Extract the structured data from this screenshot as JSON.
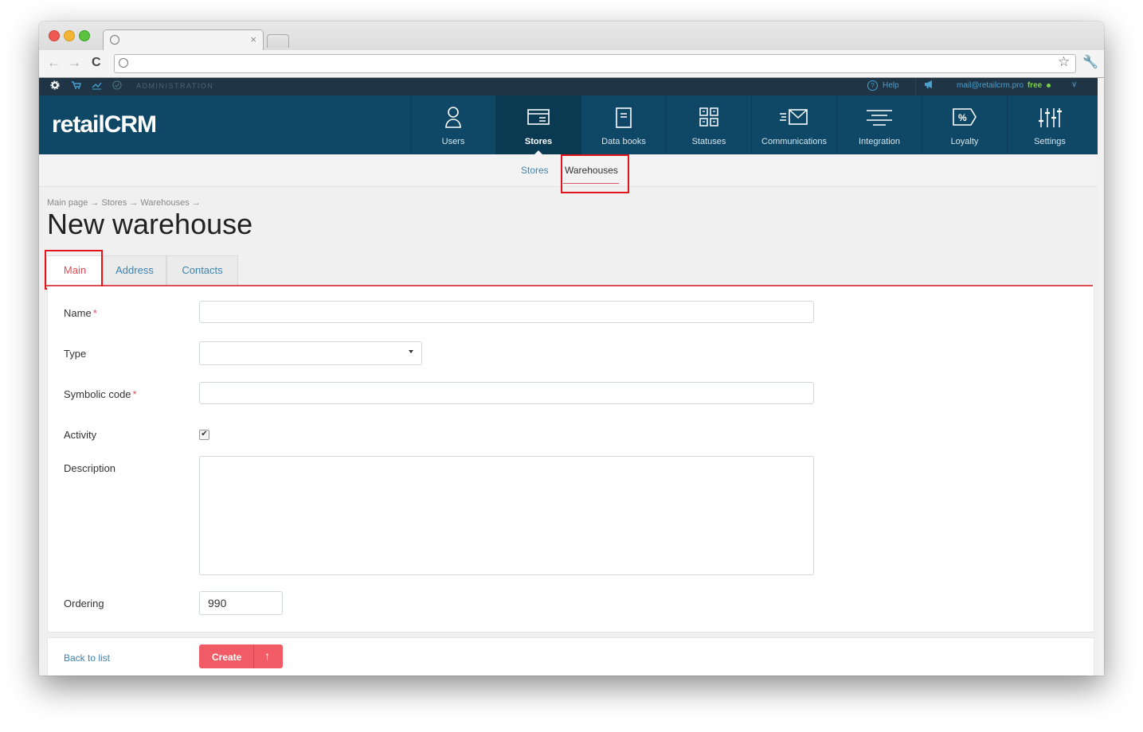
{
  "browser": {
    "tab_close": "×",
    "back_arrow": "←",
    "forward_arrow": "→",
    "reload_icon": "C",
    "star_icon": "☆",
    "wrench_icon": "🔧"
  },
  "adminbar": {
    "label": "ADMINISTRATION",
    "help": "Help",
    "email": "mail@retailcrm.pro",
    "plan": "free"
  },
  "logo": "retailCRM",
  "nav": [
    {
      "label": "Users",
      "icon": "user-icon"
    },
    {
      "label": "Stores",
      "icon": "store-icon"
    },
    {
      "label": "Data books",
      "icon": "databook-icon"
    },
    {
      "label": "Statuses",
      "icon": "statuses-icon"
    },
    {
      "label": "Communications",
      "icon": "communications-icon"
    },
    {
      "label": "Integration",
      "icon": "integration-icon"
    },
    {
      "label": "Loyalty",
      "icon": "loyalty-icon"
    },
    {
      "label": "Settings",
      "icon": "settings-icon"
    }
  ],
  "subnav": {
    "stores": "Stores",
    "warehouses": "Warehouses"
  },
  "breadcrumb": "Main page → Stores → Warehouses →",
  "page_title": "New warehouse",
  "form_tabs": [
    "Main",
    "Address",
    "Contacts"
  ],
  "form": {
    "name_label": "Name",
    "type_label": "Type",
    "symbolic_code_label": "Symbolic code",
    "activity_label": "Activity",
    "description_label": "Description",
    "ordering_label": "Ordering",
    "ordering_value": "990",
    "required_mark": "*",
    "activity_checked": true
  },
  "footer": {
    "back_to_list": "Back to list",
    "create": "Create",
    "create_arrow": "↑"
  },
  "colors": {
    "brand_nav": "#0e4866",
    "accent_red": "#e04c55",
    "link_blue": "#3b83b0",
    "highlight_box": "#e2141c"
  }
}
